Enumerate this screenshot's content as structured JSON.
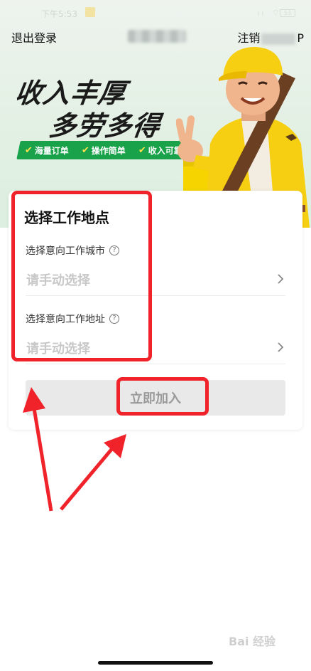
{
  "status_bar": {
    "time": "下午5:53",
    "signal_icons": "ₗₗ ⌔",
    "battery": "53"
  },
  "nav": {
    "logout_label": "退出登录",
    "cancel_prefix": "注销",
    "cancel_suffix": "P"
  },
  "banner": {
    "slogan_line1": "收入丰厚",
    "slogan_line2": "多劳多得",
    "perks": [
      "海量订单",
      "操作简单",
      "收入可靠"
    ]
  },
  "form": {
    "title": "选择工作地点",
    "city_label": "选择意向工作城市",
    "city_placeholder": "请手动选择",
    "address_label": "选择意向工作地址",
    "address_placeholder": "请手动选择",
    "help_icon_glyph": "?",
    "submit_label": "立即加入"
  },
  "watermark": "Bai 经验",
  "colors": {
    "accent_green": "#19a24a",
    "annotation_red": "#f0232a",
    "button_bg": "#e9e9e9"
  }
}
